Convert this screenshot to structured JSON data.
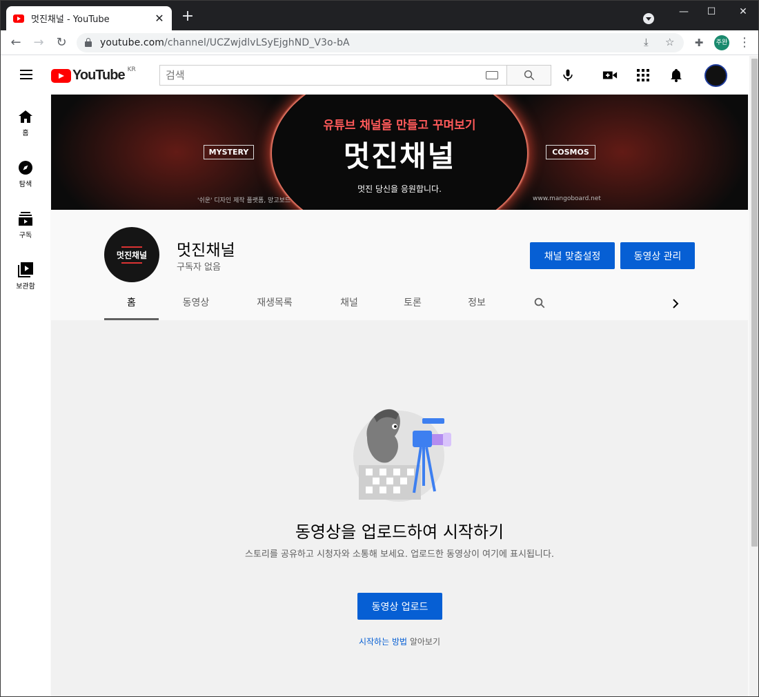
{
  "browser": {
    "tab_title": "멋진채널 - YouTube",
    "url_host": "youtube.com",
    "url_path": "/channel/UCZwjdlvLSyEjghND_V3o-bA",
    "profile_label": "주완"
  },
  "youtube": {
    "logo_text": "YouTube",
    "region": "KR",
    "search_placeholder": "검색",
    "guide": [
      {
        "label": "홈",
        "icon": "home-icon"
      },
      {
        "label": "탐색",
        "icon": "explore-icon"
      },
      {
        "label": "구독",
        "icon": "subscriptions-icon"
      },
      {
        "label": "보관함",
        "icon": "library-icon"
      }
    ]
  },
  "banner": {
    "subtitle": "유튜브 채널을 만들고 꾸며보기",
    "title": "멋진채널",
    "tagline": "멋진 당신을 응원합니다.",
    "left_box": "MYSTERY",
    "right_box": "COSMOS",
    "footer_left": "'쉬운' 디자인 제작 플랫폼, 망고보드",
    "footer_right": "www.mangoboard.net"
  },
  "channel": {
    "name": "멋진채널",
    "subscribers": "구독자 없음",
    "customize_button": "채널 맞춤설정",
    "manage_button": "동영상 관리",
    "avatar_text": "멋진채널",
    "tabs": [
      "홈",
      "동영상",
      "재생목록",
      "채널",
      "토론",
      "정보"
    ],
    "active_tab": "홈"
  },
  "empty_state": {
    "headline": "동영상을 업로드하여 시작하기",
    "description": "스토리를 공유하고 시청자와 소통해 보세요. 업로드한 동영상이 여기에 표시됩니다.",
    "upload_button": "동영상 업로드",
    "learn_link": "시작하는 방법",
    "learn_suffix": " 알아보기"
  },
  "colors": {
    "accent_blue": "#065fd4",
    "youtube_red": "#ff0000",
    "banner_red": "#ff5a5a"
  }
}
